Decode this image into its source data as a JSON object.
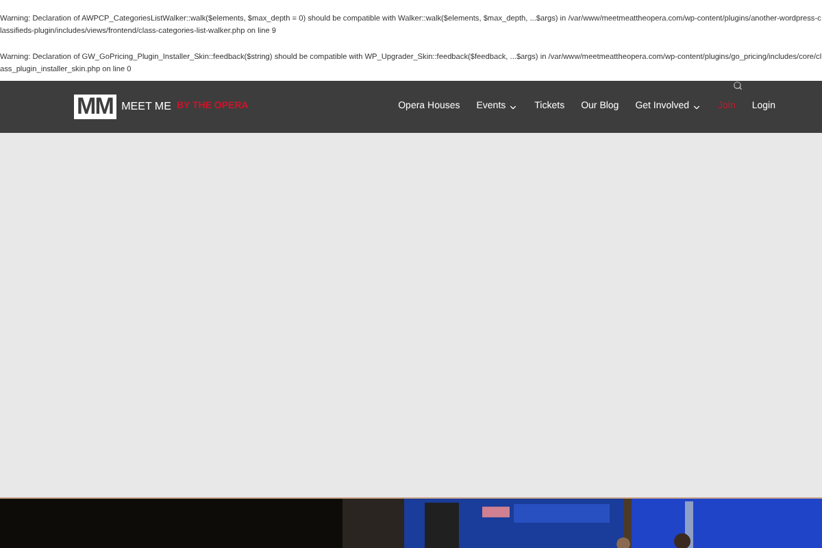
{
  "warnings": [
    "Warning: Declaration of AWPCP_CategoriesListWalker::walk($elements, $max_depth = 0) should be compatible with Walker::walk($elements, $max_depth, ...$args) in /var/www/meetmeattheopera.com/wp-content/plugins/another-wordpress-classifieds-plugin/includes/views/frontend/class-categories-list-walker.php on line 9",
    "Warning: Declaration of GW_GoPricing_Plugin_Installer_Skin::feedback($string) should be compatible with WP_Upgrader_Skin::feedback($feedback, ...$args) in /var/www/meetmeattheopera.com/wp-content/plugins/go_pricing/includes/core/class_plugin_installer_skin.php on line 0"
  ],
  "logo": {
    "mark": "MM",
    "text": "MEET ME",
    "accent": "BY THE OPERA"
  },
  "nav": [
    {
      "label": "Opera Houses",
      "dropdown": false,
      "highlight": false
    },
    {
      "label": "Events",
      "dropdown": true,
      "highlight": false
    },
    {
      "label": "Tickets",
      "dropdown": false,
      "highlight": false
    },
    {
      "label": "Our Blog",
      "dropdown": false,
      "highlight": false
    },
    {
      "label": "Get Involved",
      "dropdown": true,
      "highlight": false
    },
    {
      "label": "Join",
      "dropdown": false,
      "highlight": true
    },
    {
      "label": "Login",
      "dropdown": false,
      "highlight": false
    }
  ]
}
